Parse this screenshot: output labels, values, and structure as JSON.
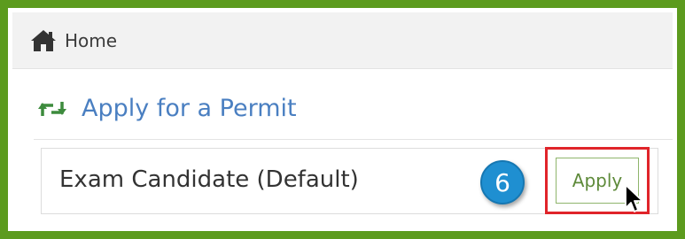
{
  "breadcrumb": {
    "home_label": "Home",
    "icon": "home-icon"
  },
  "section": {
    "title": "Apply for a Permit",
    "icon": "retweet-arrows-icon",
    "accent_color": "#4a7fc1",
    "icon_color": "#3d8b3d"
  },
  "permit": {
    "label": "Exam Candidate (Default)",
    "apply_label": "Apply",
    "step_number": "6"
  },
  "colors": {
    "frame_border": "#5c9b1e",
    "highlight": "#e0242a",
    "badge": "#1f8fd1",
    "button_text": "#5e8a3a"
  }
}
